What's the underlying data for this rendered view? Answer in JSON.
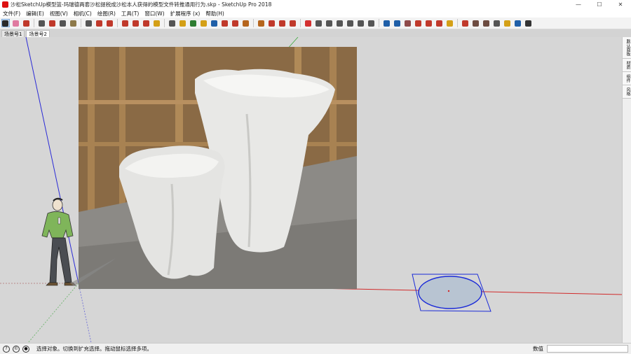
{
  "window": {
    "title": "沙松SketchUp模型篮-玛瑞德两套沙松提税成沙松本人获得的模型文件转推通用行为.skp - SketchUp Pro 2018",
    "controls": [
      "—",
      "☐",
      "✕"
    ]
  },
  "menu": [
    "文件(F)",
    "编辑(E)",
    "视图(V)",
    "相机(C)",
    "绘图(R)",
    "工具(T)",
    "窗口(W)",
    "扩展程序 (x)",
    "帮助(H)"
  ],
  "toolbar": {
    "tools": [
      {
        "name": "select-icon",
        "color": "#2a2a2a",
        "active": true
      },
      {
        "name": "eraser-icon",
        "color": "#e07aa0"
      },
      {
        "name": "pencil-icon",
        "color": "#c0392b"
      },
      {
        "name": "dropdown-arrow-icon",
        "color": "#555555"
      },
      {
        "name": "arc-icon",
        "color": "#c0392b"
      },
      {
        "name": "dropdown-arrow-icon",
        "color": "#555555"
      },
      {
        "name": "shape-icon",
        "color": "#8e7a4a"
      },
      {
        "name": "dropdown-arrow-icon",
        "color": "#555555"
      },
      {
        "name": "push-pull-icon",
        "color": "#c0392b"
      },
      {
        "name": "offset-icon",
        "color": "#c0392b"
      },
      {
        "name": "move-icon",
        "color": "#c0392b"
      },
      {
        "name": "rotate-icon",
        "color": "#c0392b"
      },
      {
        "name": "scale-icon",
        "color": "#c0392b"
      },
      {
        "name": "tape-measure-icon",
        "color": "#d4a017"
      },
      {
        "name": "text-icon",
        "color": "#555555"
      },
      {
        "name": "paint-bucket-icon",
        "color": "#d4a017"
      },
      {
        "name": "orbit-icon",
        "color": "#2e7d32"
      },
      {
        "name": "pan-icon",
        "color": "#d4a017"
      },
      {
        "name": "zoom-icon",
        "color": "#1f5fa8"
      },
      {
        "name": "zoom-extents-icon",
        "color": "#c0392b"
      },
      {
        "name": "warehouse-icon",
        "color": "#c0392b"
      },
      {
        "name": "extension-warehouse-icon",
        "color": "#b5651d"
      },
      {
        "name": "model-info-icon",
        "color": "#b5651d"
      },
      {
        "name": "ruby-icon",
        "color": "#c0392b"
      },
      {
        "name": "layout-icon",
        "color": "#c0392b"
      },
      {
        "name": "send-to-layout-icon",
        "color": "#c0392b"
      },
      {
        "name": "style-icon",
        "color": "#d32f2f"
      },
      {
        "name": "iso-view-icon",
        "color": "#555555"
      },
      {
        "name": "top-view-icon",
        "color": "#555555"
      },
      {
        "name": "front-view-icon",
        "color": "#555555"
      },
      {
        "name": "right-view-icon",
        "color": "#555555"
      },
      {
        "name": "back-view-icon",
        "color": "#555555"
      },
      {
        "name": "left-view-icon",
        "color": "#555555"
      },
      {
        "name": "xray-icon",
        "color": "#1f5fa8"
      },
      {
        "name": "wireframe-icon",
        "color": "#1f5fa8"
      },
      {
        "name": "hidden-line-icon",
        "color": "#8e4a4a"
      },
      {
        "name": "shaded-icon",
        "color": "#c0392b"
      },
      {
        "name": "textured-icon",
        "color": "#c0392b"
      },
      {
        "name": "sandbox-icon",
        "color": "#c0392b"
      },
      {
        "name": "section-plane-icon",
        "color": "#d4a017"
      },
      {
        "name": "section-display-icon",
        "color": "#c0392b"
      },
      {
        "name": "solid-tools-icon",
        "color": "#6d4c41"
      },
      {
        "name": "outer-shell-icon",
        "color": "#6d4c41"
      },
      {
        "name": "intersect-icon",
        "color": "#555555"
      },
      {
        "name": "location-icon",
        "color": "#d4a017"
      },
      {
        "name": "add-location-icon",
        "color": "#1f5fa8"
      },
      {
        "name": "outliner-icon",
        "color": "#333333"
      }
    ]
  },
  "scene_tabs": [
    "场景号1",
    "场景号2"
  ],
  "tray_tabs": [
    "默认面板",
    "材质",
    "组件",
    "风格"
  ],
  "status": {
    "text": "选择对象。切换到扩充选择。拖动鼠标选择多项。",
    "measure_label": "数值",
    "measure_value": ""
  }
}
